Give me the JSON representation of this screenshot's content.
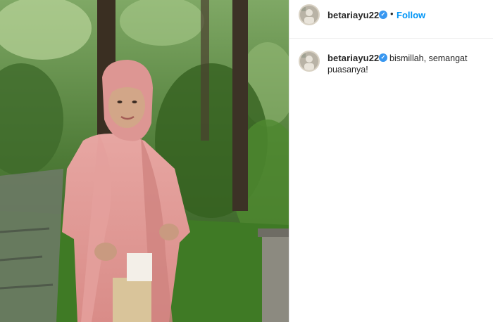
{
  "post": {
    "username": "betariayu22",
    "verified_icon": "verified-badge-icon",
    "separator": "•",
    "follow_label": "Follow",
    "caption_part1": "bismillah, semangat",
    "caption_part2": "puasanya!"
  },
  "colors": {
    "accent": "#0095f6",
    "verified": "#3897f0",
    "text": "#262626"
  }
}
